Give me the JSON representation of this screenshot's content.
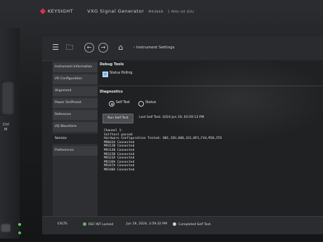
{
  "device": {
    "brand": "KEYSIGHT",
    "product": "VXG Signal Generator",
    "model": "M9384B",
    "range": "1 MHz-44 GHz",
    "hw_label_1": "Ctrl",
    "hw_label_2": "M"
  },
  "toolbar": {
    "breadcrumb": "Instrument Settings"
  },
  "sidebar": {
    "items": [
      {
        "label": "Instrument Information"
      },
      {
        "label": "I/O Configuration"
      },
      {
        "label": "Alignment"
      },
      {
        "label": "Power On/Preset"
      },
      {
        "label": "Reference"
      },
      {
        "label": "I/Q Waveform"
      },
      {
        "label": "Service"
      },
      {
        "label": "Preferences"
      }
    ],
    "active_index": 6
  },
  "debug_tools": {
    "title": "Debug Tools",
    "status_polling_label": "Status Polling",
    "status_polling_checked": true
  },
  "diagnostics": {
    "title": "Diagnostics",
    "options": [
      "Self Test",
      "Status"
    ],
    "selected": "Self Test",
    "run_button": "Run Self Test",
    "last_self_test": "Last Self Test: 2024 Jun 19, 03:59:13 PM",
    "results": [
      "Channel 1:",
      "Selftest passed",
      "Hardware Configuration Tested: 001,1EH,600,1G1,KP1,F44,M10,ST6",
      "M9043A Connected",
      "M9312B Connected",
      "M9314B Connected",
      "M9315B Connected",
      "M9323A Connected",
      "M9339A Connected",
      "M9347A Connected",
      "M9348A Connected"
    ]
  },
  "statusbar": {
    "channel": "EXLTS",
    "reference": "REF INT Locked",
    "datetime": "Jun 19, 2024, 3:59:32 PM",
    "message": "Completed Self Test."
  },
  "colors": {
    "accent": "#6fb4ff",
    "ok": "#6ab06a"
  }
}
